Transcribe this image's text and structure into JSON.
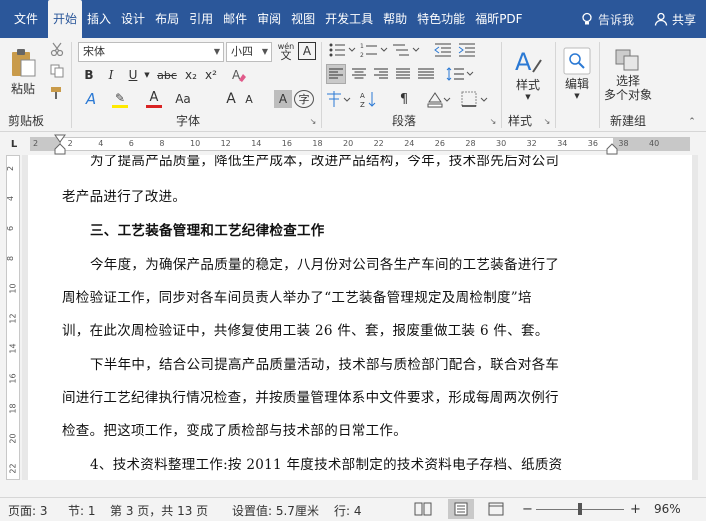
{
  "menu": {
    "tabs": [
      "文件",
      "开始",
      "插入",
      "设计",
      "布局",
      "引用",
      "邮件",
      "审阅",
      "视图",
      "开发工具",
      "帮助",
      "特色功能",
      "福昕PDF"
    ],
    "tell_me": "告诉我",
    "share": "共享"
  },
  "ribbon": {
    "clipboard": {
      "paste": "粘贴",
      "label": "剪贴板"
    },
    "font": {
      "name": "宋体",
      "size": "小四",
      "label": "字体",
      "wen": "wén",
      "bold": "B",
      "italic": "I",
      "underline": "U",
      "strike": "abc",
      "sub": "x₂",
      "sup": "x²",
      "grow": "A",
      "shrink": "A",
      "aa": "Aa",
      "char_shading": "A"
    },
    "paragraph": {
      "label": "段落"
    },
    "styles": {
      "button": "样式",
      "label": "样式"
    },
    "editing": {
      "button": "编辑"
    },
    "select_objects": {
      "button_line1": "选择",
      "button_line2": "多个对象",
      "label": "新建组"
    }
  },
  "ruler": {
    "h_ticks": [
      "2",
      "2",
      "4",
      "6",
      "8",
      "10",
      "12",
      "14",
      "16",
      "18",
      "20",
      "22",
      "24",
      "26",
      "28",
      "30",
      "32",
      "34",
      "36",
      "38",
      "40"
    ],
    "v_ticks": [
      "2",
      "4",
      "6",
      "8",
      "10",
      "12",
      "14",
      "16",
      "18",
      "20",
      "22"
    ],
    "tab_stop": "L"
  },
  "document": {
    "lines": [
      "为了提高产品质量，降低生产成本，改进产品结构，今年，技术部先后对公司",
      "老产品进行了改进。",
      "三、工艺装备管理和工艺纪律检查工作",
      "今年度，为确保产品质量的稳定，八月份对公司各生产车间的工艺装备进行了",
      "周检验证工作，同步对各车间员责人举办了“工艺装备管理规定及周检制度”培",
      "训，在此次周检验证中，共修复使用工装 26 件、套，报废重做工装 6 件、套。",
      "下半年中，结合公司提高产品质量活动，技术部与质检部门配合，联合对各车",
      "间进行工艺纪律执行情况检查，并按质量管理体系中文件要求，形成每周两次例行",
      "检查。把这项工作，变成了质检部与技术部的日常工作。",
      "4、技术资料整理工作:按 2011 年度技术部制定的技术资料电子存档、纸质资"
    ]
  },
  "status": {
    "page": "页面: 3",
    "section": "节: 1",
    "page_of": "第 3 页，共 13 页",
    "setting": "设置值: 5.7厘米",
    "row": "行: 4",
    "zoom": "96%"
  }
}
